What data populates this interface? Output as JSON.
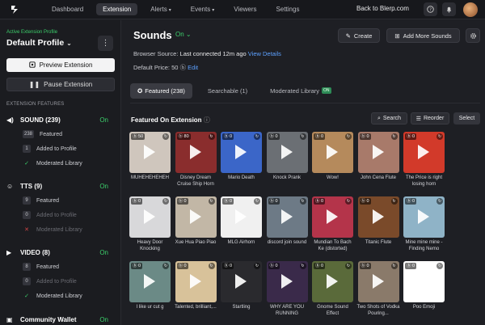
{
  "nav": {
    "items": [
      {
        "label": "Dashboard",
        "active": false,
        "dropdown": false
      },
      {
        "label": "Extension",
        "active": true,
        "dropdown": false
      },
      {
        "label": "Alerts",
        "active": false,
        "dropdown": true
      },
      {
        "label": "Events",
        "active": false,
        "dropdown": true
      },
      {
        "label": "Viewers",
        "active": false,
        "dropdown": false
      },
      {
        "label": "Settings",
        "active": false,
        "dropdown": false
      }
    ],
    "back_link": "Back to Blerp.com",
    "icons": [
      "blerp-logo-icon",
      "help-icon",
      "bell-icon",
      "avatar"
    ]
  },
  "sidebar": {
    "label": "Active Extension Profile",
    "profile": "Default Profile",
    "preview_button": "Preview Extension",
    "pause_button": "Pause Extension",
    "section_label": "EXTENSION FEATURES",
    "features": [
      {
        "name": "SOUND (239)",
        "status": "On",
        "icon": "sound-icon",
        "subs": [
          {
            "badge": "238",
            "label": "Featured",
            "type": "badge",
            "muted": false
          },
          {
            "badge": "1",
            "label": "Added to Profile",
            "type": "badge",
            "muted": false
          },
          {
            "badge": "",
            "label": "Moderated Library",
            "type": "check",
            "muted": false
          }
        ]
      },
      {
        "name": "TTS (9)",
        "status": "On",
        "icon": "tts-icon",
        "subs": [
          {
            "badge": "9",
            "label": "Featured",
            "type": "badge",
            "muted": false
          },
          {
            "badge": "0",
            "label": "Added to Profile",
            "type": "badge",
            "muted": true
          },
          {
            "badge": "",
            "label": "Moderated Library",
            "type": "cross",
            "muted": true
          }
        ]
      },
      {
        "name": "VIDEO (8)",
        "status": "On",
        "icon": "video-icon",
        "subs": [
          {
            "badge": "8",
            "label": "Featured",
            "type": "badge",
            "muted": false
          },
          {
            "badge": "0",
            "label": "Added to Profile",
            "type": "badge",
            "muted": true
          },
          {
            "badge": "",
            "label": "Moderated Library",
            "type": "check",
            "muted": false
          }
        ]
      },
      {
        "name": "Community Wallet",
        "status": "On",
        "icon": "wallet-icon",
        "subs": []
      }
    ]
  },
  "main": {
    "title": "Sounds",
    "title_status": "On",
    "create_button": "Create",
    "add_button": "Add More Sounds",
    "source_label": "Browser Source:",
    "source_value": "Last connected 12m ago",
    "view_details": "View Details",
    "price_label": "Default Price:",
    "price_value": "50",
    "edit_label": "Edit",
    "tabs": [
      {
        "label": "Featured (238)",
        "active": true,
        "badge": ""
      },
      {
        "label": "Searchable (1)",
        "active": false,
        "badge": ""
      },
      {
        "label": "Moderated Library",
        "active": false,
        "badge": "ON"
      }
    ],
    "section_title": "Featured On Extension",
    "search_button": "Search",
    "reorder_button": "Reorder",
    "select_button": "Select"
  },
  "cards": [
    {
      "price": "50",
      "caption": "MUHEHEHEHEH",
      "bg": "#cfc6bd"
    },
    {
      "price": "80",
      "caption": "Disney Dream Cruise Ship Horn",
      "bg": "#8a2d2d"
    },
    {
      "price": "0",
      "caption": "Mario Death",
      "bg": "#3b66c8"
    },
    {
      "price": "0",
      "caption": "Knock Prank",
      "bg": "#6b6f74"
    },
    {
      "price": "0",
      "caption": "Wow!",
      "bg": "#b58a5c"
    },
    {
      "price": "0",
      "caption": "John Cena Flute",
      "bg": "#a87a6a"
    },
    {
      "price": "0",
      "caption": "The Price is right losing horn",
      "bg": "#d23a2a"
    },
    {
      "price": "0",
      "caption": "Heavy Door Knocking",
      "bg": "#d8d8da"
    },
    {
      "price": "0",
      "caption": "Xue Hua Piao Piao",
      "bg": "#c2b7a6"
    },
    {
      "price": "0",
      "caption": "MLG Airhorn",
      "bg": "#f0f0f0"
    },
    {
      "price": "0",
      "caption": "discord join sound",
      "bg": "#6d7a86"
    },
    {
      "price": "0",
      "caption": "Mundian To Bach Ke (distorted)",
      "bg": "#b4344a"
    },
    {
      "price": "0",
      "caption": "Titanic Flute",
      "bg": "#7a4a2a"
    },
    {
      "price": "0",
      "caption": "Mine mine mine - Finding Nemo",
      "bg": "#8fb3c7"
    },
    {
      "price": "0",
      "caption": "I like ur cut g",
      "bg": "#6b8a86"
    },
    {
      "price": "0",
      "caption": "Talented, brilliant,...",
      "bg": "#d8c29a"
    },
    {
      "price": "0",
      "caption": "Startling",
      "bg": "#2a2a2e"
    },
    {
      "price": "0",
      "caption": "WHY ARE YOU RUNNING",
      "bg": "#3a2a4a"
    },
    {
      "price": "0",
      "caption": "Gnome Sound Effect",
      "bg": "#5a6a3a"
    },
    {
      "price": "0",
      "caption": "Two Shots of Vodka Pouring...",
      "bg": "#8a7a6a"
    },
    {
      "price": "0",
      "caption": "Poo Emoji",
      "bg": "#ffffff"
    }
  ],
  "colors": {
    "accent_green": "#3ccf6b",
    "link_blue": "#5da1ff",
    "background": "#1e1f24"
  }
}
